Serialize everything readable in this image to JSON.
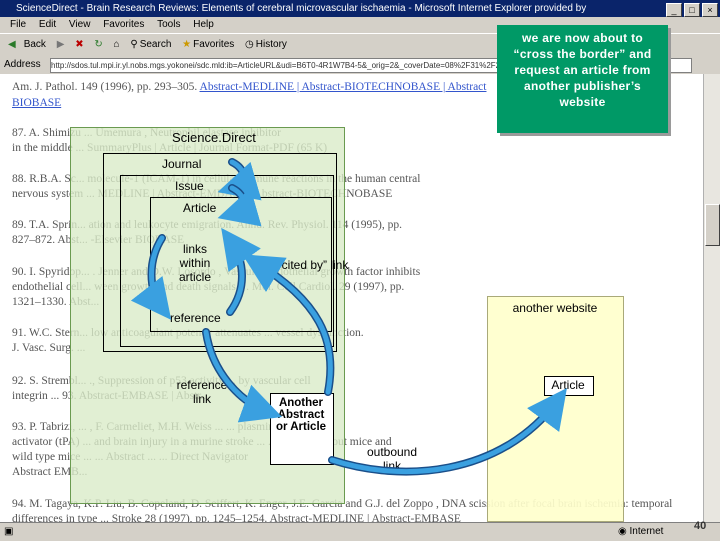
{
  "browser": {
    "title": "ScienceDirect - Brain Research Reviews: Elements of cerebral microvascular ischaemia - Microsoft Internet Explorer provided by",
    "window_buttons": [
      "_",
      "□",
      "×"
    ],
    "menu": [
      "File",
      "Edit",
      "View",
      "Favorites",
      "Tools",
      "Help"
    ],
    "toolbar": {
      "back": "Back",
      "search": "Search",
      "favorites": "Favorites",
      "history": "History"
    },
    "address_label": "Address",
    "address_value": "http://sdos.tul.mpi.ir.yl.nobs.mgs.yokonei/sdc.mld:ib=ArticleURL&udi=B6T0-4R1W7B4-5&_orig=2&_coverDate=08%2F31%2F2",
    "status_zone": "Internet"
  },
  "page_refs": {
    "r0": "Am. J. Pathol. 149 (1996), pp. 293–305.",
    "r0_links": "Abstract-MEDLINE | Abstract-BIOTECHNOBASE | Abstract",
    "r0b": "BIOBASE",
    "r87": "87. A. Shimizu ... Umemura , Neutrophil elastase inhibitor",
    "r87b": "in the middle ...   SummaryPlus | Article | Journal Format-PDF (65 K)",
    "r88": "88. R.B.A. Sc...                molecule-1 (ICAM-1) in cellular immune reactions in the human central",
    "r88b": "nervous system ...  MEDLINE | Abstract-EMBASE | Abstract-BIOTECHNOBASE",
    "r89": "89. T.A. Sprin...              ation and leukocyte emigration. Annu. Rev. Physiol. 114 (1995), pp.",
    "r89b": "827–872. Abst...              -Elsevier BIOBASE",
    "r90": "90. I. Spyridop...             . Jenner and D.W. Losordo , Vascular endothelial growth factor inhibits",
    "r90b": "endothelial cell...            ween growth and death signals. J. Mol. Cell Cardiol. 29 (1997), pp.",
    "r90c": "1321–1330. Abst...",
    "r91": "91. W.C. Stern...              low anticoagulant potency attenuates ... vessel dysfunction.",
    "r91b": "J. Vasc. Surg. ...",
    "r92": "92. S. Strembl...              ., Suppression of p53 activity ...   by vascular cell",
    "r92b": "integrin ...                  93. Abstract-EMBASE | Abstr...",
    "r93": "93. P. Tabrizi, ...            , F. Carmeliet, M.H. Weiss ...   ... plasminogen",
    "r93b": "activator (tPA) ...           and brain injury in a murine stroke ...   ... gene knockout mice and",
    "r93c": "wild type mice ...            ... Abstract ...   ... Direct Navigator",
    "r93d": "Abstract EMB...",
    "r94": "94. M. Tagaya, K.P. Liu, B. Copeland, D. Seiffert, K. Enger, J.E. Garcia and G.J. del Zoppo , DNA scission after focal brain ischemia: temporal",
    "r94b": "differences in type ... Stroke 28 (1997), pp. 1245–1254. Abstract-MEDLINE | Abstract-EMBASE"
  },
  "callout": {
    "text": "we are now about to “cross the border” and request an article from another publisher’s website"
  },
  "diagram": {
    "sciencedirect_label": "Science.Direct",
    "journal_label": "Journal",
    "issue_label": "Issue",
    "article_label": "Article",
    "links_within_label": "links within article",
    "reference_label": "reference",
    "cited_by_label": "“cited by” link",
    "reference_link_label": "reference link",
    "another_abstract_label": "Another Abstract or Article",
    "outbound_link_label": "outbound link",
    "another_website_label": "another website",
    "article2_label": "Article"
  },
  "colors": {
    "callout_bg": "#009966",
    "arrow_blue": "#3aa0e0",
    "panel_green": "#daebc8",
    "panel_yellow": "#ffffcc"
  },
  "slide_number": "40"
}
